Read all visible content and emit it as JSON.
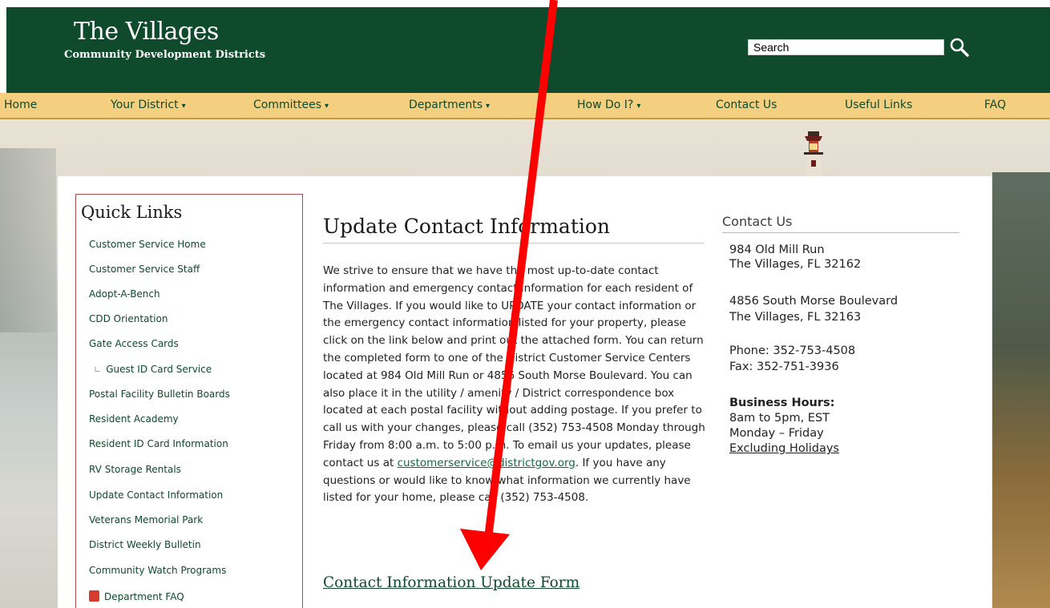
{
  "header": {
    "logo_title": "The Villages",
    "logo_subtitle": "Community Development Districts",
    "search_placeholder": "Search"
  },
  "nav": {
    "items": [
      {
        "label": "Home"
      },
      {
        "label": "Your District"
      },
      {
        "label": "Committees"
      },
      {
        "label": "Departments"
      },
      {
        "label": "How Do I?"
      },
      {
        "label": "Contact Us"
      },
      {
        "label": "Useful Links"
      },
      {
        "label": "FAQ"
      }
    ],
    "dropdown_arrow": "▾"
  },
  "quick_links": {
    "title": "Quick Links",
    "items": [
      {
        "label": "Customer Service Home"
      },
      {
        "label": "Customer Service Staff"
      },
      {
        "label": "Adopt-A-Bench"
      },
      {
        "label": "CDD Orientation"
      },
      {
        "label": "Gate Access Cards"
      },
      {
        "label": "Guest ID Card Service"
      },
      {
        "label": "Postal Facility Bulletin Boards"
      },
      {
        "label": "Resident Academy"
      },
      {
        "label": "Resident ID Card Information"
      },
      {
        "label": "RV Storage Rentals"
      },
      {
        "label": "Update Contact Information"
      },
      {
        "label": "Veterans Memorial Park"
      },
      {
        "label": "District Weekly Bulletin"
      },
      {
        "label": "Community Watch Programs"
      },
      {
        "label": "Department FAQ"
      }
    ],
    "sub_marker": "∟"
  },
  "main": {
    "title": "Update Contact Information",
    "body_part1": "We strive to ensure that we have the most up-to-date contact information and emergency contact information for each resident of The Villages.  If you would like to UPDATE your contact information or the emergency contact information listed for your property, please click on the link below and print out the attached form.  You can return the completed form to one of the District Customer Service Centers located at 984 Old Mill Run or 4856 South Morse Boulevard.  You can also place it in the utility / amenity / District correspondence box located at each postal facility without adding postage.  If you prefer to call us with your changes, please call (352) 753-4508 Monday through Friday from 8:00 a.m. to 5:00 p.m.  To email us your updates, please contact us at ",
    "email": "customerservice@districtgov.org",
    "body_part2": ".  If you have any questions or would like to know what information we currently have listed for your home, please call (352) 753-4508.",
    "form_link": "Contact Information Update Form"
  },
  "contact": {
    "title": "Contact Us",
    "address1_line1": "984 Old Mill Run",
    "address1_line2": "The Villages, FL 32162",
    "address2_line1": "4856 South Morse Boulevard",
    "address2_line2": "The Villages, FL 32163",
    "phone": "Phone: 352-753-4508",
    "fax": "Fax: 352-751-3936",
    "hours_label": "Business Hours:",
    "hours_time": "8am to 5pm, EST",
    "hours_days": "Monday – Friday",
    "holidays_link": "Excluding Holidays"
  },
  "colors": {
    "header_green": "#0f4a2c",
    "nav_gold": "#f3cf7f",
    "link_green": "#0f6a3e",
    "annotation_red": "#ff0000",
    "quick_links_border": "#a94a4a"
  }
}
